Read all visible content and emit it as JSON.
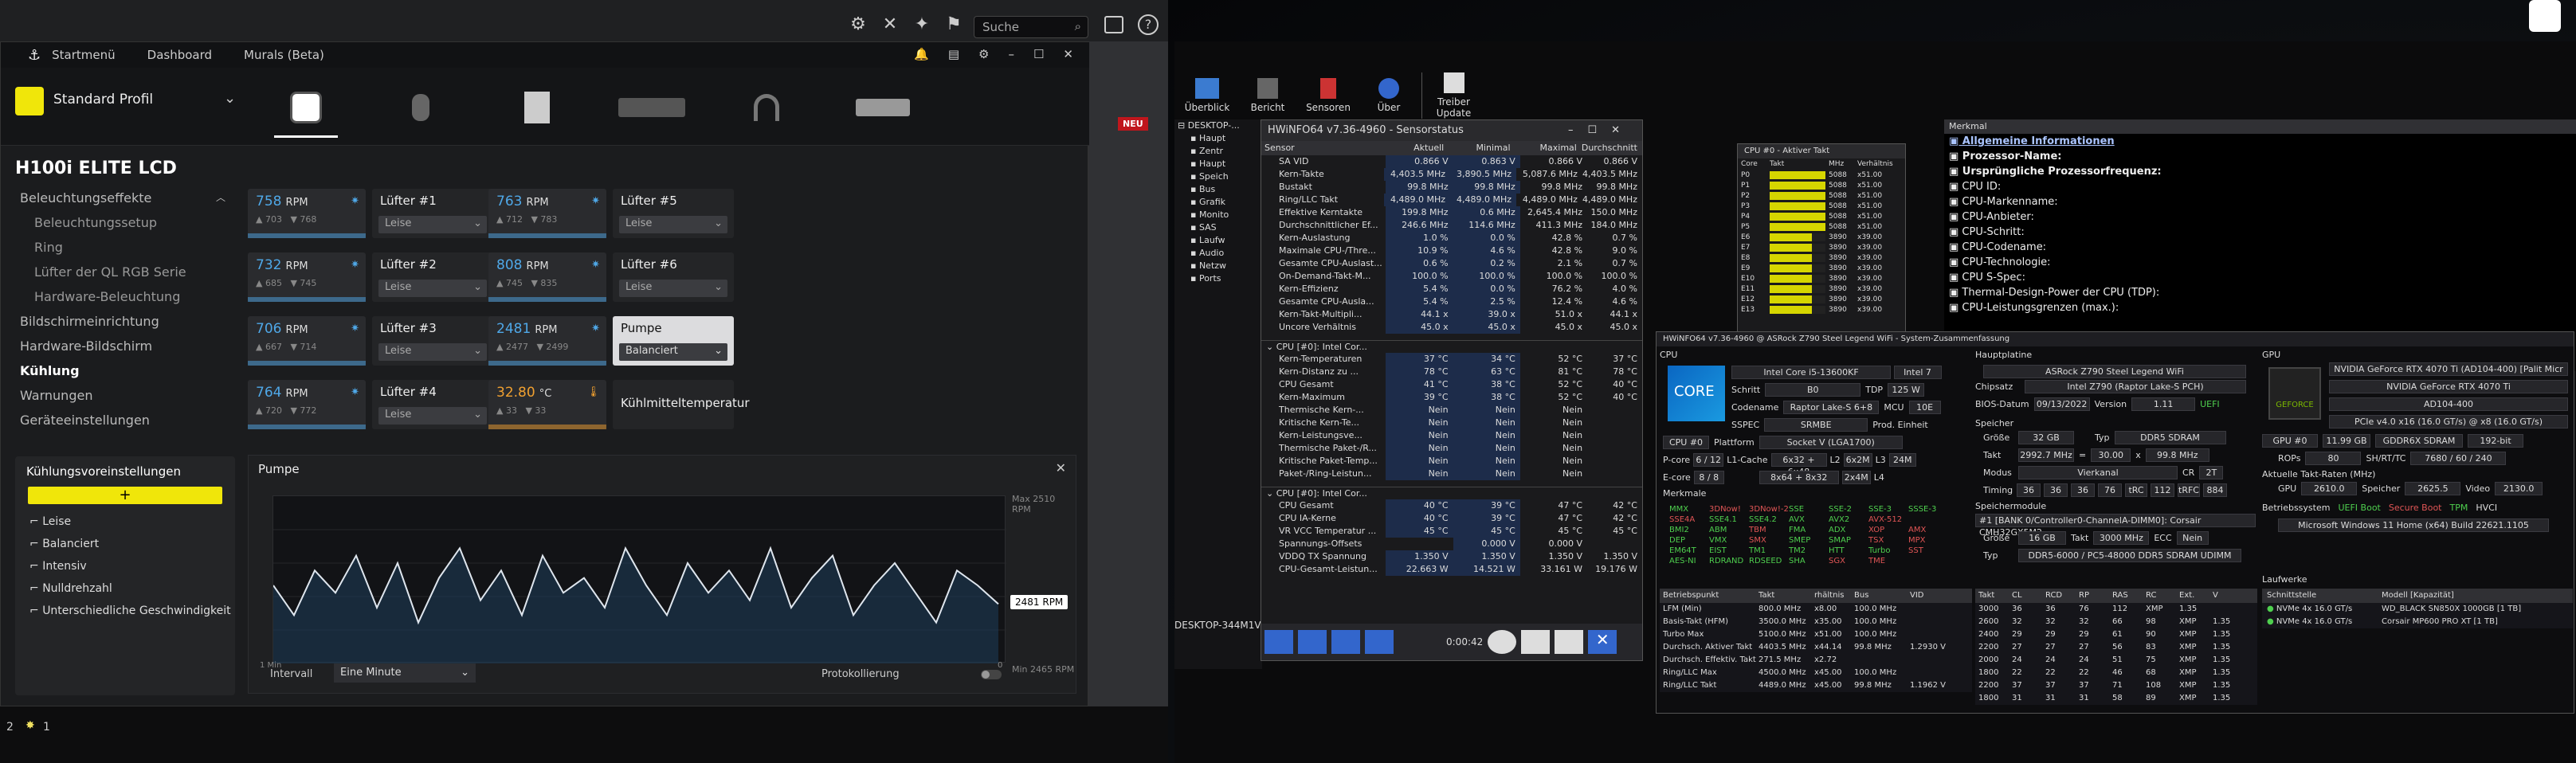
{
  "topbar": {
    "search_placeholder": "Suche"
  },
  "icue": {
    "nav": [
      "Startmenü",
      "Dashboard",
      "Murals (Beta)"
    ],
    "profile": "Standard Profil",
    "badge": "NEU",
    "device_title": "H100i ELITE LCD",
    "sidebar": [
      {
        "label": "Beleuchtungseffekte",
        "level": 0
      },
      {
        "label": "Beleuchtungssetup",
        "level": 1
      },
      {
        "label": "Ring",
        "level": 1
      },
      {
        "label": "Lüfter der QL RGB Serie",
        "level": 1
      },
      {
        "label": "Hardware-Beleuchtung",
        "level": 1
      },
      {
        "label": "Bildschirmeinrichtung",
        "level": 0
      },
      {
        "label": "Hardware-Bildschirm",
        "level": 0
      },
      {
        "label": "Kühlung",
        "level": 0,
        "active": true
      },
      {
        "label": "Warnungen",
        "level": 0
      },
      {
        "label": "Geräteeinstellungen",
        "level": 0
      }
    ],
    "presets_title": "Kühlungsvoreinstellungen",
    "presets": [
      "Leise",
      "Balanciert",
      "Intensiv",
      "Nulldrehzahl",
      "Unterschiedliche Geschwindigkeit"
    ],
    "tiles": [
      {
        "value": "758",
        "unit": "RPM",
        "min": "703",
        "max": "768",
        "name": "Lüfter #1",
        "mode": "Leise"
      },
      {
        "value": "732",
        "unit": "RPM",
        "min": "685",
        "max": "745",
        "name": "Lüfter #2",
        "mode": "Leise"
      },
      {
        "value": "706",
        "unit": "RPM",
        "min": "667",
        "max": "714",
        "name": "Lüfter #3",
        "mode": "Leise"
      },
      {
        "value": "764",
        "unit": "RPM",
        "min": "720",
        "max": "772",
        "name": "Lüfter #4",
        "mode": "Leise"
      },
      {
        "value": "763",
        "unit": "RPM",
        "min": "712",
        "max": "783",
        "name": "Lüfter #5",
        "mode": "Leise"
      },
      {
        "value": "808",
        "unit": "RPM",
        "min": "745",
        "max": "835",
        "name": "Lüfter #6",
        "mode": "Leise"
      },
      {
        "value": "2481",
        "unit": "RPM",
        "min": "2477",
        "max": "2499",
        "name": "Pumpe",
        "mode": "Balanciert"
      },
      {
        "value": "32.80",
        "unit": "°C",
        "min": "33",
        "max": "33",
        "name": "Kühlmitteltemperatur",
        "mode": ""
      }
    ],
    "pump_panel": {
      "title": "Pumpe",
      "max_label": "Max 2510 RPM",
      "min_label": "Min 2465 RPM",
      "current": "2481 RPM",
      "x_left": "1 Min",
      "x_right": "0",
      "interval_label": "Intervall",
      "interval_value": "Eine Minute",
      "logging_label": "Protokollierung"
    },
    "pump_series": [
      2486,
      2478,
      2490,
      2484,
      2494,
      2480,
      2492,
      2476,
      2488,
      2496,
      2482,
      2490,
      2478,
      2494,
      2484,
      2488,
      2480,
      2496,
      2486,
      2478,
      2492,
      2484,
      2490,
      2482,
      2496,
      2480,
      2488,
      2494,
      2478,
      2486,
      2492,
      2484,
      2476,
      2490,
      2486,
      2481
    ]
  },
  "taskbar": {
    "items": [
      "2",
      "1"
    ]
  },
  "hwinfo": {
    "toolbar": [
      "Überblick",
      "Bericht",
      "Sensoren",
      "Über",
      "Treiber Update"
    ],
    "tree_items": [
      "DESKTOP-...",
      "Haupt",
      "Zentr",
      "Haupt",
      "Speich",
      "Bus",
      "Grafik",
      "Monito",
      "SAS",
      "Laufw",
      "Audio",
      "Netzw",
      "Ports"
    ],
    "tree_footer": "DESKTOP-344M1VF",
    "sensor_title": "HWiNFO64 v7.36-4960 - Sensorstatus",
    "sensor_headers": [
      "Sensor",
      "Aktuell",
      "Minimal",
      "Maximal",
      "Durchschnitt"
    ],
    "sensor_rows": [
      [
        "SA VID",
        "0.866 V",
        "0.863 V",
        "0.866 V",
        "0.866 V"
      ],
      [
        "Kern-Takte",
        "4,403.5 MHz",
        "3,890.5 MHz",
        "5,087.6 MHz",
        "4,403.5 MHz"
      ],
      [
        "Bustakt",
        "99.8 MHz",
        "99.8 MHz",
        "99.8 MHz",
        "99.8 MHz"
      ],
      [
        "Ring/LLC Takt",
        "4,489.0 MHz",
        "4,489.0 MHz",
        "4,489.0 MHz",
        "4,489.0 MHz"
      ],
      [
        "Effektive Kerntakte",
        "199.8 MHz",
        "0.6 MHz",
        "2,645.4 MHz",
        "150.0 MHz"
      ],
      [
        "Durchschnittlicher Ef...",
        "246.6 MHz",
        "114.6 MHz",
        "411.3 MHz",
        "184.0 MHz"
      ],
      [
        "Kern-Auslastung",
        "1.0 %",
        "0.0 %",
        "42.8 %",
        "0.7 %"
      ],
      [
        "Maximale CPU-/Thre...",
        "10.9 %",
        "4.6 %",
        "42.8 %",
        "9.0 %"
      ],
      [
        "Gesamte CPU-Auslast...",
        "0.6 %",
        "0.2 %",
        "2.1 %",
        "0.7 %"
      ],
      [
        "On-Demand-Takt-M...",
        "100.0 %",
        "100.0 %",
        "100.0 %",
        "100.0 %"
      ],
      [
        "Kern-Effizienz",
        "5.4 %",
        "0.0 %",
        "76.2 %",
        "4.0 %"
      ],
      [
        "Gesamte CPU-Ausla...",
        "5.4 %",
        "2.5 %",
        "12.4 %",
        "4.6 %"
      ],
      [
        "Kern-Takt-Multipli...",
        "44.1 x",
        "39.0 x",
        "51.0 x",
        "44.1 x"
      ],
      [
        "Uncore Verhältnis",
        "45.0 x",
        "45.0 x",
        "45.0 x",
        "45.0 x"
      ]
    ],
    "sensor_group2": "CPU [#0]: Intel Cor...",
    "sensor_rows2": [
      [
        "Kern-Temperaturen",
        "37 °C",
        "34 °C",
        "52 °C",
        "37 °C"
      ],
      [
        "Kern-Distanz zu ...",
        "78 °C",
        "63 °C",
        "81 °C",
        "78 °C"
      ],
      [
        "CPU Gesamt",
        "41 °C",
        "38 °C",
        "52 °C",
        "40 °C"
      ],
      [
        "Kern-Maximum",
        "39 °C",
        "38 °C",
        "52 °C",
        "40 °C"
      ],
      [
        "Thermische Kern-...",
        "Nein",
        "Nein",
        "Nein",
        ""
      ],
      [
        "Kritische Kern-Te...",
        "Nein",
        "Nein",
        "Nein",
        ""
      ],
      [
        "Kern-Leistungsve...",
        "Nein",
        "Nein",
        "Nein",
        ""
      ],
      [
        "Thermische Paket-/R...",
        "Nein",
        "Nein",
        "Nein",
        ""
      ],
      [
        "Kritische Paket-Temp...",
        "Nein",
        "Nein",
        "Nein",
        ""
      ],
      [
        "Paket-/Ring-Leistun...",
        "Nein",
        "Nein",
        "Nein",
        ""
      ]
    ],
    "sensor_group3": "CPU [#0]: Intel Cor...",
    "sensor_rows3": [
      [
        "CPU Gesamt",
        "40 °C",
        "39 °C",
        "47 °C",
        "42 °C"
      ],
      [
        "CPU IA-Kerne",
        "40 °C",
        "39 °C",
        "47 °C",
        "42 °C"
      ],
      [
        "VR VCC Temperatur ...",
        "45 °C",
        "45 °C",
        "45 °C",
        "45 °C"
      ],
      [
        "Spannungs-Offsets",
        "",
        "0.000 V",
        "0.000 V",
        ""
      ],
      [
        "VDDQ TX Spannung",
        "1.350 V",
        "1.350 V",
        "1.350 V",
        "1.350 V"
      ],
      [
        "CPU-Gesamt-Leistun...",
        "22.663 W",
        "14.521 W",
        "33.161 W",
        "19.176 W"
      ]
    ],
    "sensor_footer": {
      "time": "0:00:42"
    },
    "cpu_clock": {
      "title": "CPU #0 - Aktiver Takt",
      "headers": [
        "Core",
        "Takt",
        "MHz",
        "Verhältnis"
      ],
      "rows": [
        [
          "P0",
          "5088",
          "x51.00"
        ],
        [
          "P1",
          "5088",
          "x51.00"
        ],
        [
          "P2",
          "5088",
          "x51.00"
        ],
        [
          "P3",
          "5088",
          "x51.00"
        ],
        [
          "P4",
          "5088",
          "x51.00"
        ],
        [
          "P5",
          "5088",
          "x51.00"
        ],
        [
          "E6",
          "3890",
          "x39.00"
        ],
        [
          "E7",
          "3890",
          "x39.00"
        ],
        [
          "E8",
          "3890",
          "x39.00"
        ],
        [
          "E9",
          "3890",
          "x39.00"
        ],
        [
          "E10",
          "3890",
          "x39.00"
        ],
        [
          "E11",
          "3890",
          "x39.00"
        ],
        [
          "E12",
          "3890",
          "x39.00"
        ],
        [
          "E13",
          "3890",
          "x39.00"
        ]
      ]
    },
    "info_panel": {
      "header": "Merkmal",
      "items": [
        "Allgemeine Informationen",
        "Prozessor-Name:",
        "Ursprüngliche Prozessorfrequenz:",
        "CPU ID:",
        "CPU-Markenname:",
        "CPU-Anbieter:",
        "CPU-Schritt:",
        "CPU-Codename:",
        "CPU-Technologie:",
        "CPU S-Spec:",
        "Thermal-Design-Power der CPU (TDP):",
        "CPU-Leistungsgrenzen (max.):"
      ]
    },
    "summary": {
      "title": "HWiNFO64 v7.36-4960 @ ASRock Z790 Steel Legend WiFi - System-Zusammenfassung",
      "cpu_label": "CPU",
      "cpu_name": "Intel Core i5-13600KF",
      "node": "Intel 7",
      "stepping_label": "Schritt",
      "stepping": "B0",
      "tdp_label": "TDP",
      "tdp": "125 W",
      "codename_label": "Codename",
      "codename": "Raptor Lake-S 6+8",
      "mcu_label": "MCU",
      "mcu": "10E",
      "sspec_label": "SSPEC",
      "sspec": "SRMBE",
      "prod_label": "Prod. Einheit",
      "platform_label": "Plattform",
      "platform": "Socket V (LGA1700)",
      "cpu_select": "CPU #0",
      "pcore_label": "P-core",
      "pcore": "6 / 12",
      "l1_label": "L1-Cache",
      "l1": "6x32 + 6x48",
      "l2_label": "L2",
      "l2": "6x2M",
      "l3_label": "L3",
      "l3": "24M",
      "ecore_label": "E-core",
      "ecore": "8 / 8",
      "l1e": "8x64 + 8x32",
      "l2e": "2x4M",
      "l4_label": "L4",
      "features_label": "Merkmale",
      "features": [
        [
          "MMX",
          "3DNow!",
          "3DNow!-2",
          "SSE",
          "SSE-2",
          "SSE-3",
          "SSSE-3"
        ],
        [
          "SSE4A",
          "SSE4.1",
          "SSE4.2",
          "AVX",
          "AVX2",
          "AVX-512",
          ""
        ],
        [
          "BMI2",
          "ABM",
          "TBM",
          "FMA",
          "ADX",
          "XOP",
          "AMX"
        ],
        [
          "DEP",
          "VMX",
          "SMX",
          "SMEP",
          "SMAP",
          "TSX",
          "MPX"
        ],
        [
          "EM64T",
          "EIST",
          "TM1",
          "TM2",
          "HTT",
          "Turbo",
          "SST"
        ],
        [
          "AES-NI",
          "RDRAND",
          "RDSEED",
          "SHA",
          "SGX",
          "TME",
          ""
        ]
      ],
      "op_headers": [
        "Betriebspunkt",
        "Takt",
        "rhältnis",
        "Bus",
        "VID"
      ],
      "op_rows": [
        [
          "LFM (Min)",
          "800.0 MHz",
          "x8.00",
          "100.0 MHz",
          ""
        ],
        [
          "Basis-Takt (HFM)",
          "3500.0 MHz",
          "x35.00",
          "100.0 MHz",
          ""
        ],
        [
          "Turbo Max",
          "5100.0 MHz",
          "x51.00",
          "100.0 MHz",
          ""
        ],
        [
          "Durchsch. Aktiver Takt",
          "4403.5 MHz",
          "x44.14",
          "99.8 MHz",
          "1.2930 V"
        ],
        [
          "Durchsch. Effektiv. Takt",
          "271.5 MHz",
          "x2.72",
          "",
          ""
        ],
        [
          "Ring/LLC Max",
          "4500.0 MHz",
          "x45.00",
          "100.0 MHz",
          ""
        ],
        [
          "Ring/LLC Takt",
          "4489.0 MHz",
          "x45.00",
          "99.8 MHz",
          "1.1962 V"
        ]
      ],
      "mb_label": "Hauptplatine",
      "mb": "ASRock Z790 Steel Legend WiFi",
      "chipset_label": "Chipsatz",
      "chipset": "Intel Z790 (Raptor Lake-S PCH)",
      "bios_label": "BIOS-Datum",
      "bios": "09/13/2022",
      "version_label": "Version",
      "version": "1.11",
      "uefi": "UEFI",
      "mem_label": "Speicher",
      "mem_size_label": "Größe",
      "mem_size": "32 GB",
      "mem_type_label": "Typ",
      "mem_type": "DDR5 SDRAM",
      "clock_label": "Takt",
      "clock": "2992.7 MHz",
      "eq": "=",
      "mult": "30.00",
      "x": "x",
      "bus": "99.8 MHz",
      "mode_label": "Modus",
      "mode": "Vierkanal",
      "cr_label": "CR",
      "cr": "2T",
      "timing_label": "Timing",
      "timing": [
        "36",
        "36",
        "36",
        "76",
        "tRC",
        "112",
        "tRFC",
        "884"
      ],
      "module_label": "Speichermodule",
      "module": "#1 [BANK 0/Controller0-ChannelA-DIMM0]: Corsair CMH32GX5M2",
      "mod_size": "16 GB",
      "mod_clock_label": "Takt",
      "mod_clock": "3000 MHz",
      "ecc_label": "ECC",
      "ecc": "Nein",
      "mod_type_label": "Typ",
      "mod_type": "DDR5-6000 / PC5-48000 DDR5 SDRAM UDIMM",
      "timing_headers": [
        "Takt",
        "CL",
        "RCD",
        "RP",
        "RAS",
        "RC",
        "Ext.",
        "V"
      ],
      "timing_rows": [
        [
          "3000",
          "36",
          "36",
          "76",
          "112",
          "XMP",
          "1.35"
        ],
        [
          "2600",
          "32",
          "32",
          "32",
          "66",
          "98",
          "XMP",
          "1.35"
        ],
        [
          "2400",
          "29",
          "29",
          "29",
          "61",
          "90",
          "XMP",
          "1.35"
        ],
        [
          "2200",
          "27",
          "27",
          "27",
          "56",
          "83",
          "XMP",
          "1.35"
        ],
        [
          "2000",
          "24",
          "24",
          "24",
          "51",
          "75",
          "XMP",
          "1.35"
        ],
        [
          "1800",
          "22",
          "22",
          "22",
          "46",
          "68",
          "XMP",
          "1.35"
        ],
        [
          "2200",
          "37",
          "37",
          "37",
          "71",
          "108",
          "XMP",
          "1.35"
        ],
        [
          "1800",
          "31",
          "31",
          "31",
          "58",
          "89",
          "XMP",
          "1.35"
        ]
      ],
      "gpu_label": "GPU",
      "gpu_full": "NVIDIA GeForce RTX 4070 Ti (AD104-400) [Palit Micr",
      "gpu_name": "NVIDIA GeForce RTX 4070 Ti",
      "gpu_chip": "AD104-400",
      "gpu_pcie": "PCIe v4.0 x16 (16.0 GT/s) @ x8 (16.0 GT/s)",
      "gpu_select": "GPU #0",
      "vram": "11.99 GB",
      "vram_type": "GDDR6X SDRAM",
      "bus_width": "192-bit",
      "rops_label": "ROPs",
      "rops": "80",
      "shaders_label": "SH/RT/TC",
      "shaders": "7680 / 60 / 240",
      "clocks_label": "Aktuelle Takt-Raten (MHz)",
      "gpu_clk_label": "GPU",
      "gpu_clk": "2610.0",
      "mem_clk_label": "Speicher",
      "mem_clk": "2625.5",
      "video_label": "Video",
      "video": "2130.0",
      "os_label": "Betriebssystem",
      "os_flags": [
        "UEFI Boot",
        "Secure Boot",
        "TPM",
        "HVCI"
      ],
      "os": "Microsoft Windows 11 Home (x64) Build 22621.1105",
      "drives_label": "Laufwerke",
      "drive_headers": [
        "Schnittstelle",
        "Modell [Kapazität]"
      ],
      "drives": [
        [
          "NVMe 4x 16.0 GT/s",
          "WD_BLACK SN850X 1000GB [1 TB]"
        ],
        [
          "NVMe 4x 16.0 GT/s",
          "Corsair MP600 PRO XT [1 TB]"
        ]
      ]
    }
  },
  "colors": {
    "accent": "#f0e60a",
    "icue_blue": "#4fa8e8",
    "temp_orange": "#f0a030",
    "hw_green": "#4ecf4e",
    "hw_red": "#e05555",
    "hw_bar": "#d6d600"
  }
}
